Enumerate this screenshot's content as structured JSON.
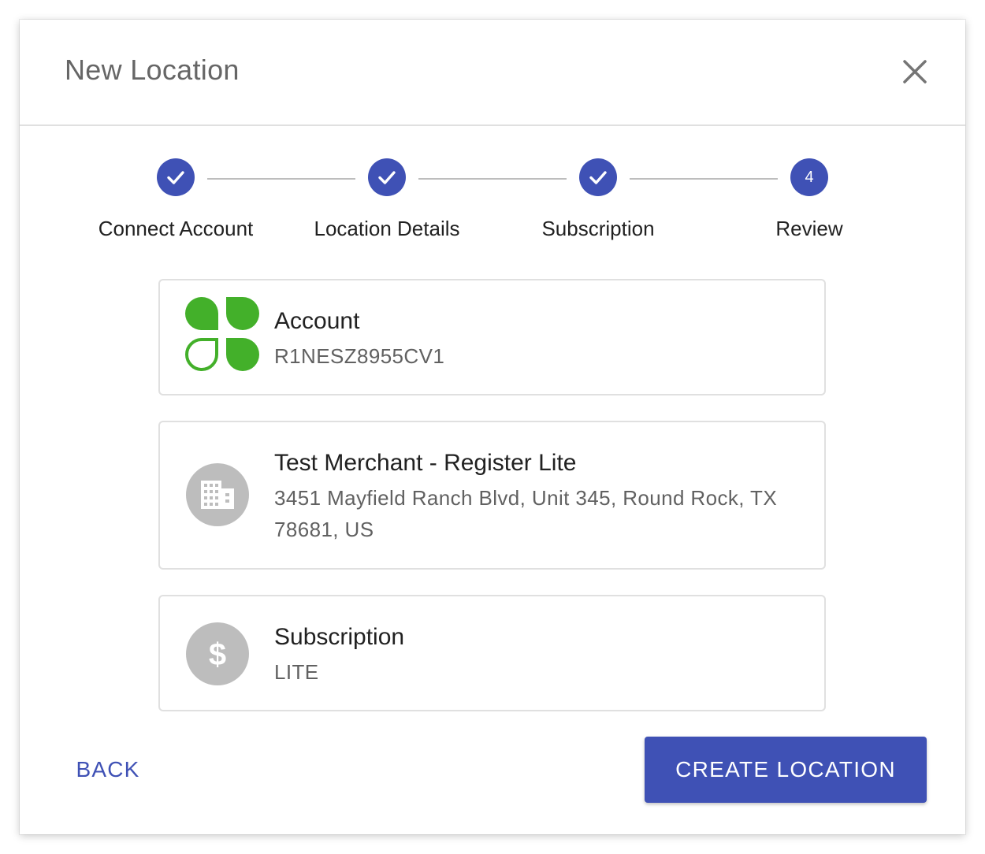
{
  "dialog": {
    "title": "New Location",
    "close_icon": "close-icon"
  },
  "stepper": {
    "active_color": "#3f51b5",
    "connector_color": "#bdbdbd",
    "steps": [
      {
        "label": "Connect Account",
        "status": "completed",
        "icon": "check-icon"
      },
      {
        "label": "Location Details",
        "status": "completed",
        "icon": "check-icon"
      },
      {
        "label": "Subscription",
        "status": "completed",
        "icon": "check-icon"
      },
      {
        "label": "Review",
        "status": "active",
        "number": "4"
      }
    ]
  },
  "cards": {
    "account": {
      "title": "Account",
      "value": "R1NESZ8955CV1",
      "icon": "clover-logo-icon",
      "logo_color": "#43b02a"
    },
    "location": {
      "title": "Test Merchant - Register Lite",
      "address_line1": "3451 Mayfield Ranch Blvd, Unit 345, Round Rock, TX",
      "address_line2": "78681, US",
      "icon": "building-icon"
    },
    "subscription": {
      "title": "Subscription",
      "value": "LITE",
      "icon": "dollar-icon"
    }
  },
  "actions": {
    "back_label": "BACK",
    "create_label": "CREATE LOCATION",
    "primary_color": "#3f51b5"
  }
}
